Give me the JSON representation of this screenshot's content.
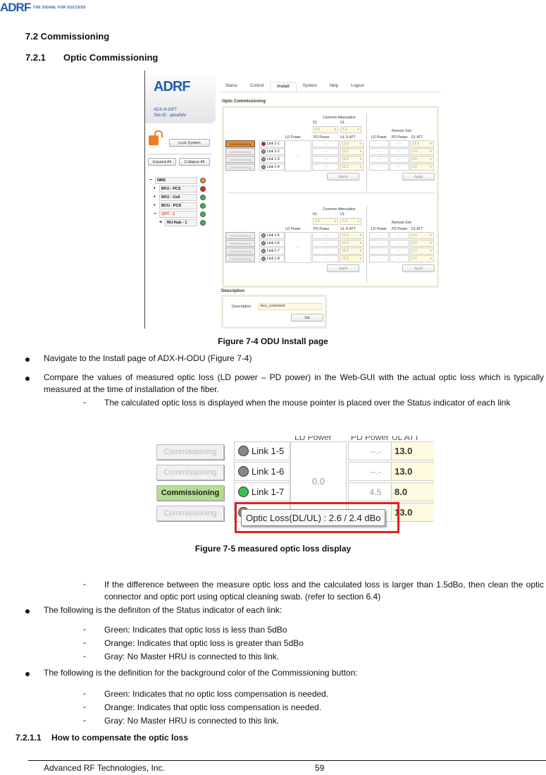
{
  "header": {
    "logo": "ADRF",
    "tagline": "THE SIGNAL FOR SUCCESS"
  },
  "sections": {
    "s72": "7.2  Commissioning",
    "s721_num": "7.2.1",
    "s721_title": "Optic Commissioning",
    "s7211_num": "7.2.1.1",
    "s7211_title": "How to compensate the optic loss"
  },
  "figure1": {
    "caption": "Figure 7-4     ODU Install page",
    "sidebar": {
      "logo": "ADRF",
      "model": "ADX-H-OPT",
      "site_id": "Site ID : abcefefe",
      "lock_button": "Lock System",
      "expand_all": "Expand All",
      "collapse_all": "Collapse All",
      "tree": [
        {
          "label": "NMS",
          "status": "#f0902a",
          "expander": "−"
        },
        {
          "label": "RFU - PCS",
          "status": "#e02020",
          "expander": "•"
        },
        {
          "label": "RFU - Cell",
          "status": "#3bb54a",
          "expander": "•"
        },
        {
          "label": "BCU - PCS",
          "status": "#3bb54a",
          "expander": "•"
        },
        {
          "label": "OPT - 1",
          "status": "#3bb54a",
          "expander": "−"
        },
        {
          "label": "RU-Hub - 1",
          "status": "#3bb54a",
          "expander": "+"
        }
      ]
    },
    "tabs": [
      "Status",
      "Control",
      "Install",
      "System",
      "Help",
      "Logout"
    ],
    "active_tab": "Install",
    "section_title": "Optic Commissioning",
    "labels": {
      "common_attenuation": "Common Attenuation",
      "dl": "DL",
      "ul": "UL",
      "ld_power": "LD Power",
      "pd_power": "PD Power",
      "ul_datt": "UL D-ATT",
      "remote_unit": "Remote Unit",
      "dl_att": "DL ATT",
      "apply": "Apply",
      "commissioning": "Commissioning",
      "placeholder": "--.-"
    },
    "groups": [
      {
        "common_dl": "5.0",
        "common_ul": "5.3",
        "ld_power": "--.-",
        "links": [
          {
            "name": "Link 1-1",
            "led": "red",
            "button": "orange",
            "pd": "--.-",
            "ul_datt": "13.0",
            "ru_ld": "--.-",
            "ru_pd": "--.-",
            "dl_att": "13.0"
          },
          {
            "name": "Link 1-2",
            "led": "gray",
            "button": "gray",
            "pd": "--.-",
            "ul_datt": "13.0",
            "ru_ld": "--.-",
            "ru_pd": "--.-",
            "dl_att": "0.0"
          },
          {
            "name": "Link 1-3",
            "led": "gray",
            "button": "gray",
            "pd": "--.-",
            "ul_datt": "13.0",
            "ru_ld": "--.-",
            "ru_pd": "--.-",
            "dl_att": "0.0"
          },
          {
            "name": "Link 1-4",
            "led": "gray",
            "button": "gray",
            "pd": "--.-",
            "ul_datt": "13.0",
            "ru_ld": "--.-",
            "ru_pd": "--.-",
            "dl_att": "0.0"
          }
        ]
      },
      {
        "common_dl": "5.0",
        "common_ul": "5.3",
        "ld_power": "--.-",
        "links": [
          {
            "name": "Link 1-5",
            "led": "gray",
            "button": "gray",
            "pd": "--.-",
            "ul_datt": "13.0",
            "ru_ld": "--.-",
            "ru_pd": "--.-",
            "dl_att": "0.0"
          },
          {
            "name": "Link 1-6",
            "led": "gray",
            "button": "gray",
            "pd": "--.-",
            "ul_datt": "13.0",
            "ru_ld": "--.-",
            "ru_pd": "--.-",
            "dl_att": "0.0"
          },
          {
            "name": "Link 1-7",
            "led": "gray",
            "button": "gray",
            "pd": "--.-",
            "ul_datt": "13.0",
            "ru_ld": "--.-",
            "ru_pd": "--.-",
            "dl_att": "0.0"
          },
          {
            "name": "Link 1-8",
            "led": "gray",
            "button": "gray",
            "pd": "--.-",
            "ul_datt": "13.0",
            "ru_ld": "--.-",
            "ru_pd": "--.-",
            "dl_att": "0.0"
          }
        ]
      }
    ],
    "description": {
      "section_title": "Description",
      "label": "Description",
      "value": "bcu_comment",
      "set_button": "Set"
    }
  },
  "figure2": {
    "caption": "Figure 7-5     measured optic loss display",
    "headers": {
      "ld_power": "LD Power",
      "pd_power": "PD Power",
      "ul_att": "UL ATT"
    },
    "ld_power": "0.0",
    "rows": [
      {
        "button": "Commissioning",
        "button_state": "gray",
        "link": "Link 1-5",
        "led": "gray",
        "pd": "--.-",
        "ul_att": "13.0"
      },
      {
        "button": "Commissioning",
        "button_state": "gray",
        "link": "Link 1-6",
        "led": "gray",
        "pd": "--.-",
        "ul_att": "13.0"
      },
      {
        "button": "Commissioning",
        "button_state": "green",
        "link": "Link 1-7",
        "led": "green",
        "pd": "4.5",
        "ul_att": "8.0"
      },
      {
        "button": "Commissioning",
        "button_state": "gray",
        "link": "",
        "led": "gray",
        "pd": "",
        "ul_att": "13.0"
      }
    ],
    "tooltip": "Optic Loss(DL/UL) : 2.6 / 2.4 dBo"
  },
  "body": {
    "b1": "Navigate to the Install page of ADX-H-ODU (Figure 7-4)",
    "b2": "Compare the values of measured optic loss (LD power – PD power) in the Web-GUI with the actual optic loss which is typically measured at the time of installation of the fiber.",
    "b2_d1": "The calculated optic loss is displayed when the mouse pointer is placed over the Status indicator of each link",
    "b2_d2": "If the difference between the measure optic loss and the calculated loss is larger than 1.5dBo, then clean the optic connector and optic port using optical cleaning swab. (refer to section 6.4)",
    "b3": "The following is the definiton of the Status indicator of each link:",
    "b3_items": [
      "Green: Indicates that optic loss is less than 5dBo",
      "Orange: Indicates that optic loss is greater than 5dBo",
      "Gray: No Master HRU is connected to this link."
    ],
    "b4": "The following is the definition for the background color of the Commissioning button:",
    "b4_items": [
      "Green: Indicates that no optic loss compensation is needed.",
      "Orange: Indicates that optic loss compensation is needed.",
      "Gray: No Master HRU is connected to this link."
    ]
  },
  "footer": {
    "company": "Advanced RF Technologies, Inc.",
    "page": "59"
  }
}
